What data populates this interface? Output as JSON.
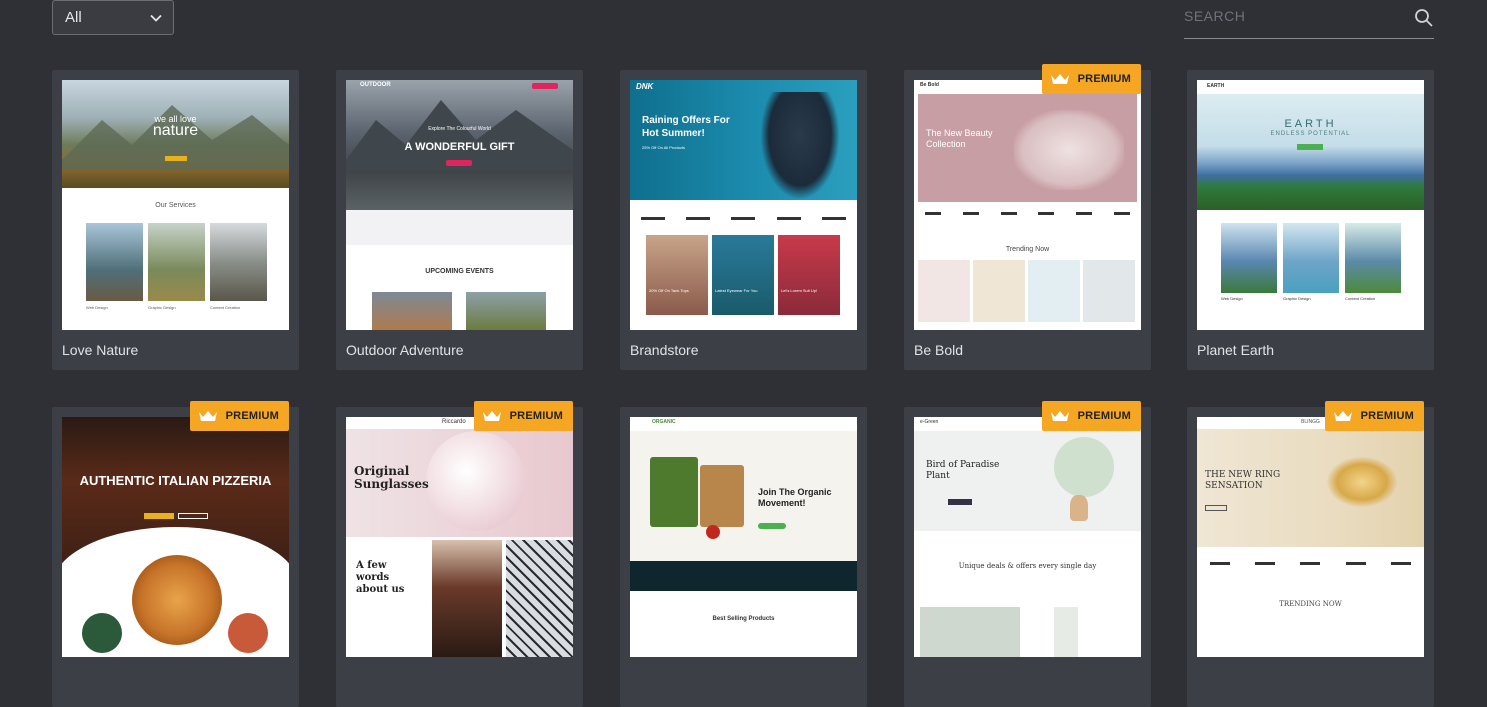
{
  "filter": {
    "selected": "All"
  },
  "search": {
    "placeholder": "SEARCH"
  },
  "badge_label": "PREMIUM",
  "templates": [
    {
      "title": "Love Nature",
      "premium": false,
      "hero_line1": "we all love",
      "hero_line2": "nature",
      "section": "Our Services",
      "cols": [
        "Web Design",
        "Graphic Design",
        "Content Creation"
      ]
    },
    {
      "title": "Outdoor Adventure",
      "premium": false,
      "logo": "OUTDOOR",
      "tagline": "Explore The Colourful World",
      "headline": "A WONDERFUL GIFT",
      "section": "UPCOMING EVENTS"
    },
    {
      "title": "Brandstore",
      "premium": false,
      "logo": "DNK",
      "headline1": "Raining Offers For",
      "headline2": "Hot Summer!",
      "sub": "25% Off On All Products",
      "tiles": [
        "20% Off On Tank Tops",
        "Latest Eyewear For You",
        "Let's Lorem Suit Up!"
      ]
    },
    {
      "title": "Be Bold",
      "premium": true,
      "logo": "Be Bold",
      "headline1": "The New Beauty",
      "headline2": "Collection",
      "section": "Trending Now"
    },
    {
      "title": "Planet Earth",
      "premium": false,
      "logo": "EARTH",
      "headline": "EARTH",
      "sub": "ENDLESS POTENTIAL",
      "cols": [
        "Web Design",
        "Graphic Design",
        "Content Creation"
      ]
    },
    {
      "title": "",
      "premium": true,
      "headline": "AUTHENTIC ITALIAN PIZZERIA"
    },
    {
      "title": "",
      "premium": true,
      "logo": "Riccardo",
      "headline1": "Original",
      "headline2": "Sunglasses",
      "quote1": "A few",
      "quote2": "words",
      "quote3": "about us"
    },
    {
      "title": "",
      "premium": false,
      "logo": "ORGANIC",
      "headline1": "Join The Organic",
      "headline2": "Movement!",
      "section": "Best Selling Products"
    },
    {
      "title": "",
      "premium": true,
      "logo": "e-Green",
      "headline1": "Bird of Paradise",
      "headline2": "Plant",
      "section": "Unique deals & offers every single day"
    },
    {
      "title": "",
      "premium": true,
      "logo": "BLINGG",
      "headline1": "THE NEW RING",
      "headline2": "SENSATION",
      "section": "TRENDING NOW"
    }
  ],
  "colors": {
    "background": "#2e3036",
    "card": "#3c3f46",
    "badge": "#f5a623"
  }
}
